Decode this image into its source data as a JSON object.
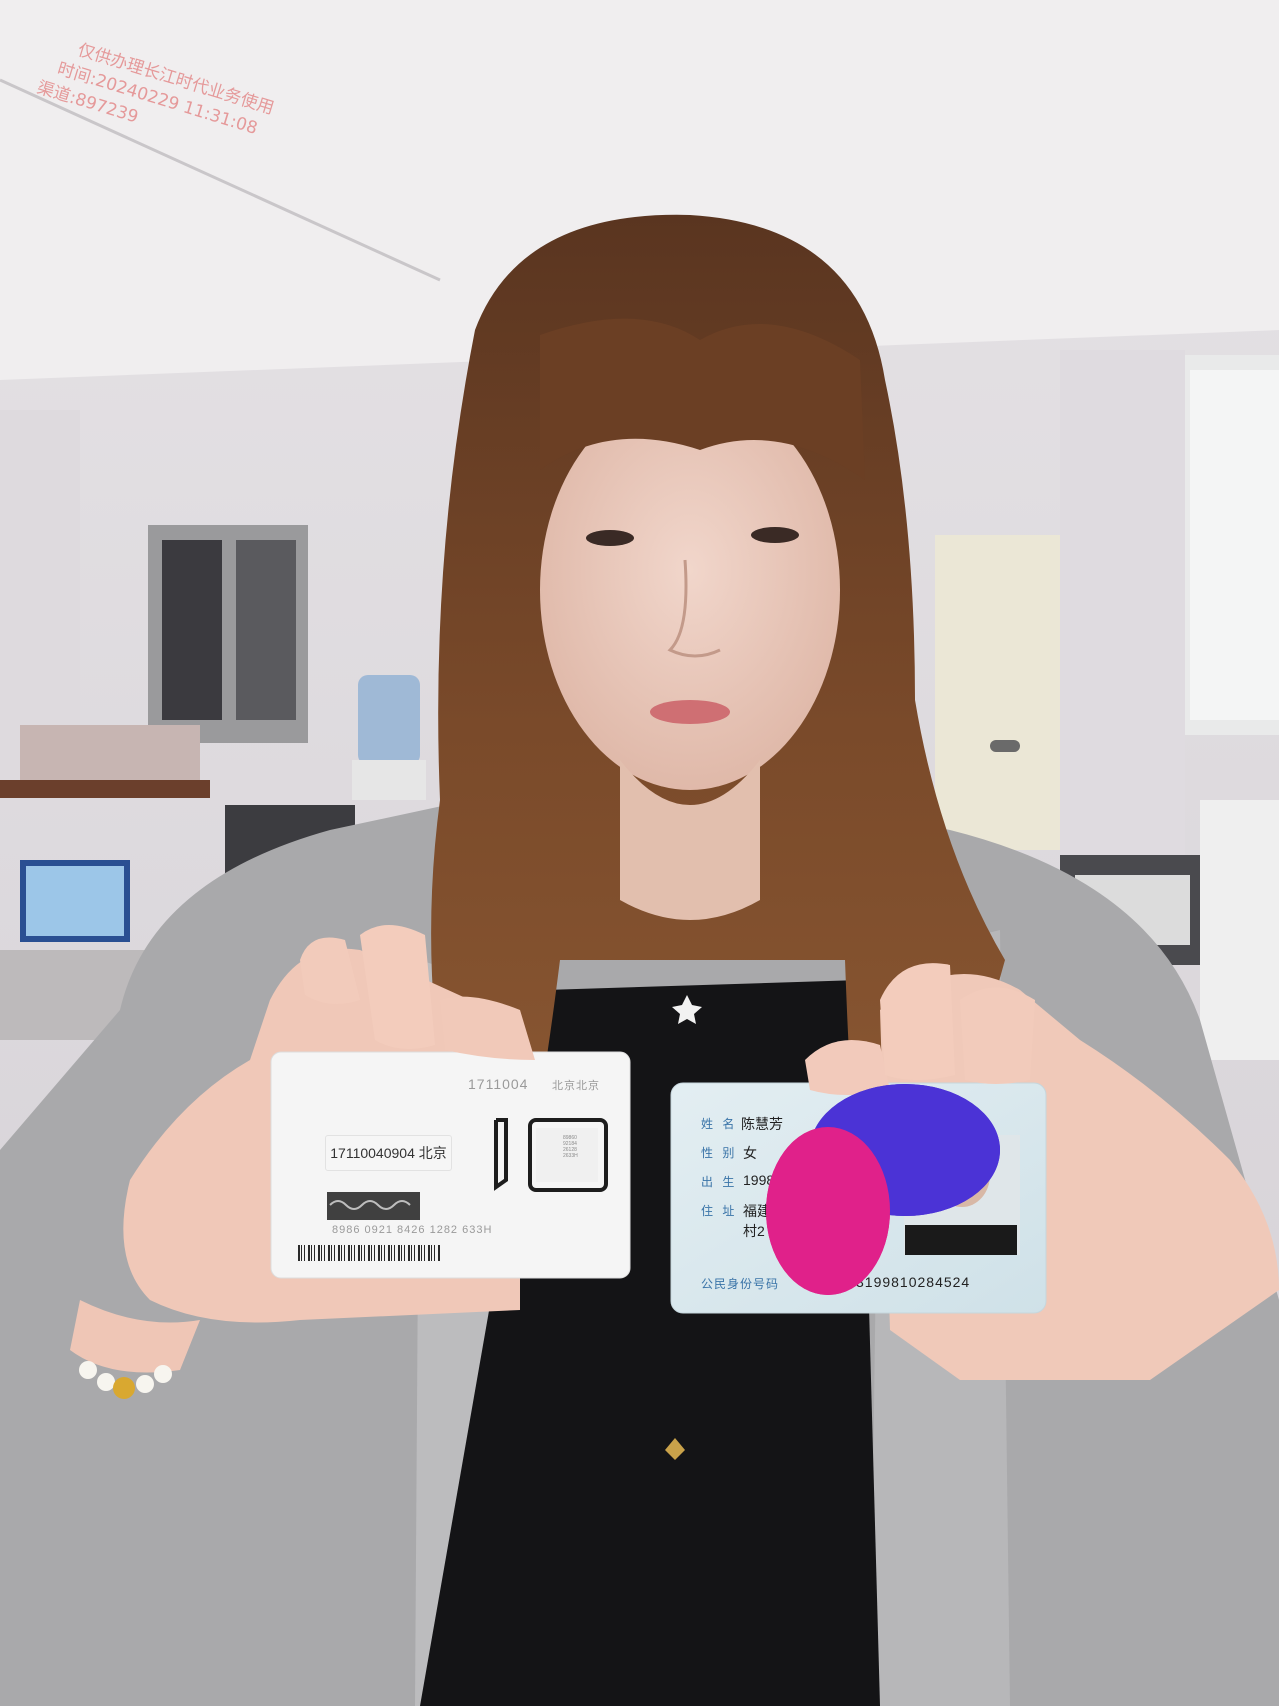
{
  "watermark": {
    "line1": "仅供办理长江时代业务使用",
    "line2": "时间:20240229  11:31:08",
    "line3": "渠道:897239"
  },
  "sim_card": {
    "top_number": "1711004",
    "top_region": "北京北京",
    "label": "17110040904 北京",
    "iccid": "8986  0921  8426  1282  633H",
    "chip_text": [
      "89860",
      "92184",
      "26128",
      "2633H"
    ]
  },
  "id_card": {
    "name_label": "姓 名",
    "name_value": "陈慧芳",
    "gender_label": "性 别",
    "gender_value": "女",
    "birth_label": "出 生",
    "birth_value": "1998",
    "address_label": "住 址",
    "address_line1": "福建",
    "address_line2": "村2",
    "id_label": "公民身份号码",
    "id_number": "3199810284524"
  },
  "redaction_colors": {
    "blue": "#4b33d6",
    "pink": "#e0218a"
  }
}
